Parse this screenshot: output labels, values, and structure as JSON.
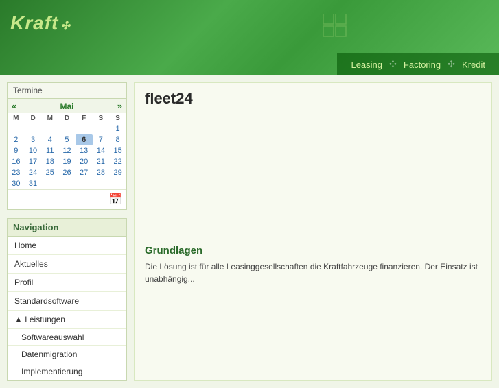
{
  "header": {
    "logo_text": "Kraft",
    "logo_icon": "✣",
    "grid_icon": "grid",
    "nav_items": [
      {
        "label": "Leasing",
        "sep": "✣"
      },
      {
        "label": "Factoring",
        "sep": "✣"
      },
      {
        "label": "Kredit",
        "sep": ""
      }
    ]
  },
  "calendar": {
    "title": "Termine",
    "month": "Mai",
    "prev": "«",
    "next": "»",
    "weekdays": [
      "M",
      "D",
      "M",
      "D",
      "F",
      "S",
      "S"
    ],
    "weeks": [
      [
        {
          "d": "",
          "c": "empty"
        },
        {
          "d": "",
          "c": "empty"
        },
        {
          "d": "",
          "c": "empty"
        },
        {
          "d": "",
          "c": "empty"
        },
        {
          "d": "",
          "c": "empty"
        },
        {
          "d": "",
          "c": "empty"
        },
        {
          "d": "1",
          "c": ""
        }
      ],
      [
        {
          "d": "2",
          "c": ""
        },
        {
          "d": "3",
          "c": ""
        },
        {
          "d": "4",
          "c": ""
        },
        {
          "d": "5",
          "c": ""
        },
        {
          "d": "6",
          "c": "today"
        },
        {
          "d": "7",
          "c": ""
        },
        {
          "d": "8",
          "c": ""
        }
      ],
      [
        {
          "d": "9",
          "c": ""
        },
        {
          "d": "10",
          "c": ""
        },
        {
          "d": "11",
          "c": ""
        },
        {
          "d": "12",
          "c": ""
        },
        {
          "d": "13",
          "c": ""
        },
        {
          "d": "14",
          "c": ""
        },
        {
          "d": "15",
          "c": ""
        }
      ],
      [
        {
          "d": "16",
          "c": ""
        },
        {
          "d": "17",
          "c": ""
        },
        {
          "d": "18",
          "c": ""
        },
        {
          "d": "19",
          "c": ""
        },
        {
          "d": "20",
          "c": ""
        },
        {
          "d": "21",
          "c": ""
        },
        {
          "d": "22",
          "c": ""
        }
      ],
      [
        {
          "d": "23",
          "c": ""
        },
        {
          "d": "24",
          "c": ""
        },
        {
          "d": "25",
          "c": ""
        },
        {
          "d": "26",
          "c": ""
        },
        {
          "d": "27",
          "c": ""
        },
        {
          "d": "28",
          "c": ""
        },
        {
          "d": "29",
          "c": ""
        }
      ],
      [
        {
          "d": "30",
          "c": ""
        },
        {
          "d": "31",
          "c": ""
        },
        {
          "d": "",
          "c": "empty"
        },
        {
          "d": "",
          "c": "empty"
        },
        {
          "d": "",
          "c": "empty"
        },
        {
          "d": "",
          "c": "empty"
        },
        {
          "d": "",
          "c": "empty"
        }
      ]
    ],
    "icon": "📅"
  },
  "navigation": {
    "title": "Navigation",
    "items": [
      {
        "label": "Home",
        "type": "item",
        "indent": false
      },
      {
        "label": "Aktuelles",
        "type": "item",
        "indent": false
      },
      {
        "label": "Profil",
        "type": "item",
        "indent": false
      },
      {
        "label": "Standardsoftware",
        "type": "item",
        "indent": false
      },
      {
        "label": "▲ Leistungen",
        "type": "toggle",
        "indent": false
      },
      {
        "label": "Softwareauswahl",
        "type": "item",
        "indent": true
      },
      {
        "label": "Datenmigration",
        "type": "item",
        "indent": true
      },
      {
        "label": "Implementierung",
        "type": "item",
        "indent": true
      }
    ]
  },
  "content": {
    "title": "fleet24",
    "subtitle": "Grundlagen",
    "text": "Die Lösung ist für alle Leasinggesellschaften die Kraftfahrzeuge finanzieren. Der Einsatz ist unabhängig..."
  }
}
